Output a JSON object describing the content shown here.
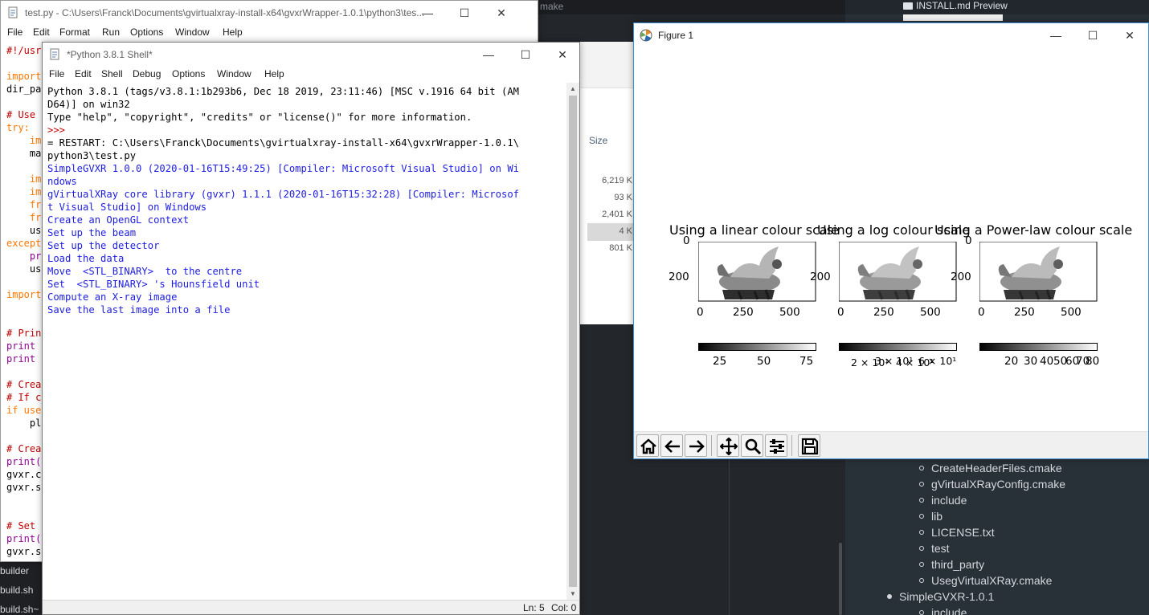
{
  "background": {
    "cmake_tab": "make",
    "markdown_tab": "INSTALL.md Preview",
    "explorer": {
      "size_header": "Size",
      "sizes": [
        "6,219 K",
        "93 K",
        "2,401 K",
        "4 K",
        "801 K"
      ]
    },
    "files": [
      "builder",
      "build.sh",
      "build.sh~"
    ],
    "markdown_tree": [
      {
        "label": "CreateHeaderFiles.cmake",
        "level": 2
      },
      {
        "label": "gVirtualXRayConfig.cmake",
        "level": 2
      },
      {
        "label": "include",
        "level": 2
      },
      {
        "label": "lib",
        "level": 2
      },
      {
        "label": "LICENSE.txt",
        "level": 2
      },
      {
        "label": "test",
        "level": 2
      },
      {
        "label": "third_party",
        "level": 2
      },
      {
        "label": "UsegVirtualXRay.cmake",
        "level": 2
      },
      {
        "label": "SimpleGVXR-1.0.1",
        "level": 1
      },
      {
        "label": "include",
        "level": 2
      }
    ]
  },
  "editor": {
    "title": "test.py - C:\\Users\\Franck\\Documents\\gvirtualxray-install-x64\\gvxrWrapper-1.0.1\\python3\\tes...",
    "menu": [
      "File",
      "Edit",
      "Format",
      "Run",
      "Options",
      "Window",
      "Help"
    ],
    "code_lines": [
      {
        "text": "#!/usr",
        "color": "#c00000"
      },
      {
        "text": "",
        "color": "#000000"
      },
      {
        "text": "import",
        "color": "#ff7700"
      },
      {
        "text": "dir_pa",
        "color": "#000000"
      },
      {
        "text": "",
        "color": "#000000"
      },
      {
        "text": "# Use ",
        "color": "#c00000"
      },
      {
        "text": "try:",
        "color": "#ff7700"
      },
      {
        "text": "    im",
        "color": "#ff7700"
      },
      {
        "text": "    ma",
        "color": "#000000"
      },
      {
        "text": "",
        "color": "#000000"
      },
      {
        "text": "    im",
        "color": "#ff7700"
      },
      {
        "text": "    im",
        "color": "#ff7700"
      },
      {
        "text": "    fr",
        "color": "#ff7700"
      },
      {
        "text": "    fr",
        "color": "#ff7700"
      },
      {
        "text": "    us",
        "color": "#000000"
      },
      {
        "text": "except",
        "color": "#ff7700"
      },
      {
        "text": "    pr",
        "color": "#900090"
      },
      {
        "text": "    us",
        "color": "#000000"
      },
      {
        "text": "",
        "color": "#000000"
      },
      {
        "text": "import",
        "color": "#ff7700"
      },
      {
        "text": "",
        "color": "#000000"
      },
      {
        "text": "",
        "color": "#000000"
      },
      {
        "text": "# Prin",
        "color": "#c00000"
      },
      {
        "text": "print ",
        "color": "#900090"
      },
      {
        "text": "print ",
        "color": "#900090"
      },
      {
        "text": "",
        "color": "#000000"
      },
      {
        "text": "# Crea",
        "color": "#c00000"
      },
      {
        "text": "# If c",
        "color": "#c00000"
      },
      {
        "text": "if use",
        "color": "#ff7700"
      },
      {
        "text": "    pl",
        "color": "#000000"
      },
      {
        "text": "",
        "color": "#000000"
      },
      {
        "text": "# Crea",
        "color": "#c00000"
      },
      {
        "text": "print(",
        "color": "#900090"
      },
      {
        "text": "gvxr.c",
        "color": "#000000"
      },
      {
        "text": "gvxr.s",
        "color": "#000000"
      },
      {
        "text": "",
        "color": "#000000"
      },
      {
        "text": "",
        "color": "#000000"
      },
      {
        "text": "# Set ",
        "color": "#c00000"
      },
      {
        "text": "print(",
        "color": "#900090"
      },
      {
        "text": "gvxr.s",
        "color": "#000000"
      }
    ]
  },
  "shell": {
    "title": "*Python 3.8.1 Shell*",
    "menu": [
      "File",
      "Edit",
      "Shell",
      "Debug",
      "Options",
      "Window",
      "Help"
    ],
    "lines": [
      {
        "text": "Python 3.8.1 (tags/v3.8.1:1b293b6, Dec 18 2019, 23:11:46) [MSC v.1916 64 bit (AM",
        "style": "black"
      },
      {
        "text": "D64)] on win32",
        "style": "black"
      },
      {
        "text": "Type \"help\", \"copyright\", \"credits\" or \"license()\" for more information.",
        "style": "black"
      },
      {
        "text": ">>>",
        "style": "red"
      },
      {
        "text": "= RESTART: C:\\Users\\Franck\\Documents\\gvirtualxray-install-x64\\gvxrWrapper-1.0.1\\",
        "style": "black"
      },
      {
        "text": "python3\\test.py",
        "style": "black"
      },
      {
        "text": "SimpleGVXR 1.0.0 (2020-01-16T15:49:25) [Compiler: Microsoft Visual Studio] on Wi",
        "style": "blue"
      },
      {
        "text": "ndows",
        "style": "blue"
      },
      {
        "text": "gVirtualXRay core library (gvxr) 1.1.1 (2020-01-16T15:32:28) [Compiler: Microsof",
        "style": "blue"
      },
      {
        "text": "t Visual Studio] on Windows",
        "style": "blue"
      },
      {
        "text": "Create an OpenGL context",
        "style": "blue"
      },
      {
        "text": "Set up the beam",
        "style": "blue"
      },
      {
        "text": "Set up the detector",
        "style": "blue"
      },
      {
        "text": "Load the data",
        "style": "blue"
      },
      {
        "text": "Move  <STL_BINARY>  to the centre",
        "style": "blue"
      },
      {
        "text": "Set  <STL_BINARY> 's Hounsfield unit",
        "style": "blue"
      },
      {
        "text": "Compute an X-ray image",
        "style": "blue"
      },
      {
        "text": "Save the last image into a file",
        "style": "blue"
      }
    ],
    "status_ln": "Ln: 5",
    "status_col": "Col: 0"
  },
  "figure": {
    "title": "Figure 1",
    "toolbar": [
      "home-icon",
      "back-icon",
      "forward-icon",
      "pan-icon",
      "zoom-icon",
      "configure-icon",
      "save-icon"
    ]
  },
  "chart_data": [
    {
      "type": "heatmap",
      "title": "Using a linear colour scale",
      "y_ticks": [
        "0",
        "200"
      ],
      "x_ticks": [
        "0",
        "250",
        "500"
      ],
      "colorbar_ticks": [
        "25",
        "50",
        "75"
      ],
      "colormap": "gray",
      "scale": "linear"
    },
    {
      "type": "heatmap",
      "title": "Using a log colour scale",
      "y_ticks": [
        "0",
        "200"
      ],
      "x_ticks": [
        "0",
        "250",
        "500"
      ],
      "colorbar_ticks": [
        "2 × 10¹",
        "3 × 10¹",
        "4 × 10¹",
        "6 × 10¹"
      ],
      "colormap": "gray",
      "scale": "log"
    },
    {
      "type": "heatmap",
      "title": "Using a Power-law colour scale",
      "y_ticks": [
        "0",
        "200"
      ],
      "x_ticks": [
        "0",
        "250",
        "500"
      ],
      "colorbar_ticks": [
        "20",
        "30",
        "40",
        "50",
        "60",
        "70",
        "80"
      ],
      "colormap": "gray",
      "scale": "power"
    }
  ]
}
